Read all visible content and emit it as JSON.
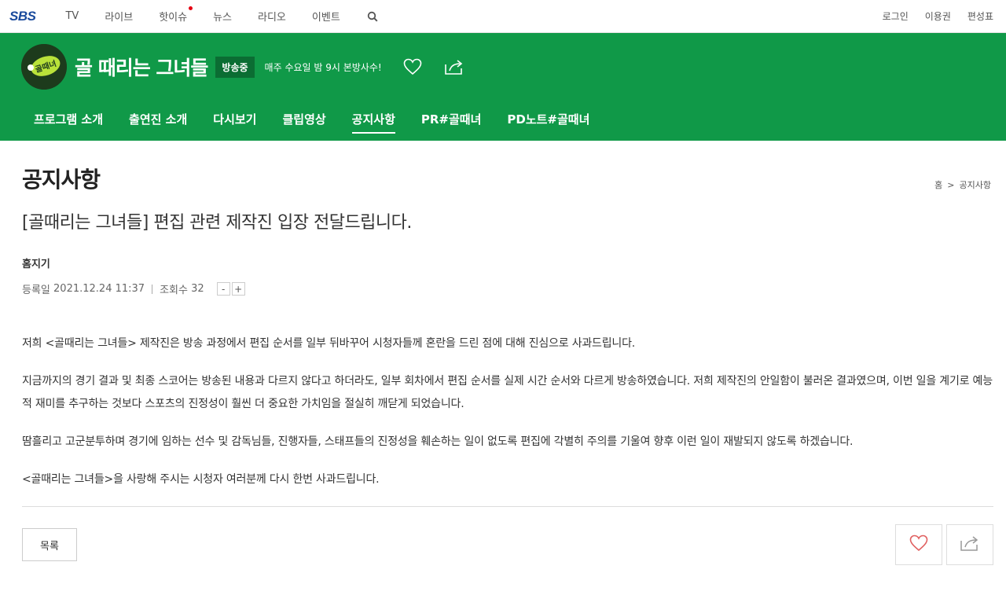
{
  "topbar": {
    "logo": "SBS",
    "nav": [
      {
        "label": "TV",
        "has_dot": false
      },
      {
        "label": "라이브",
        "has_dot": false
      },
      {
        "label": "핫이슈",
        "has_dot": true
      },
      {
        "label": "뉴스",
        "has_dot": false
      },
      {
        "label": "라디오",
        "has_dot": false
      },
      {
        "label": "이벤트",
        "has_dot": false
      }
    ],
    "search_icon": "search-icon",
    "util": [
      "로그인",
      "이용권",
      "편성표"
    ]
  },
  "program": {
    "logo_text": "골때리는 그녀들",
    "title": "골 때리는 그녀들",
    "badge": "방송중",
    "schedule": "매주 수요일 밤 9시 본방사수!",
    "icons": [
      "heart-icon",
      "share-icon"
    ],
    "menu": [
      {
        "label": "프로그램 소개",
        "active": false
      },
      {
        "label": "출연진 소개",
        "active": false
      },
      {
        "label": "다시보기",
        "active": false
      },
      {
        "label": "클립영상",
        "active": false
      },
      {
        "label": "공지사항",
        "active": true
      },
      {
        "label": "PR#골때녀",
        "active": false
      },
      {
        "label": "PD노트#골때녀",
        "active": false
      }
    ],
    "brand_color": "#109948"
  },
  "page": {
    "title": "공지사항",
    "breadcrumb": {
      "home": "홈",
      "separator": ">",
      "current": "공지사항"
    }
  },
  "notice": {
    "title": "[골때리는 그녀들] 편집 관련 제작진 입장 전달드립니다.",
    "author": "홈지기",
    "date_label": "등록일",
    "date": "2021.12.24 11:37",
    "views_label": "조회수",
    "views": "32",
    "font_minus": "-",
    "font_plus": "+",
    "paragraphs": [
      "저희 <골때리는 그녀들> 제작진은 방송 과정에서 편집 순서를 일부 뒤바꾸어 시청자들께 혼란을 드린 점에 대해 진심으로 사과드립니다.",
      "지금까지의 경기 결과 및 최종 스코어는 방송된 내용과 다르지 않다고 하더라도, 일부 회차에서 편집 순서를 실제 시간 순서와 다르게 방송하였습니다. 저희 제작진의 안일함이 불러온 결과였으며, 이번 일을 계기로 예능적 재미를 추구하는 것보다 스포츠의 진정성이 훨씬 더 중요한 가치임을 절실히 깨닫게 되었습니다.",
      "땀흘리고 고군분투하며 경기에 임하는 선수 및 감독님들, 진행자들, 스태프들의 진정성을 훼손하는 일이 없도록 편집에 각별히 주의를 기울여 향후 이런 일이 재발되지 않도록 하겠습니다.",
      "<골때리는 그녀들>을 사랑해 주시는 시청자 여러분께 다시 한번 사과드립니다."
    ]
  },
  "actions": {
    "list_label": "목록",
    "icons": [
      "heart-icon",
      "share-icon"
    ]
  }
}
